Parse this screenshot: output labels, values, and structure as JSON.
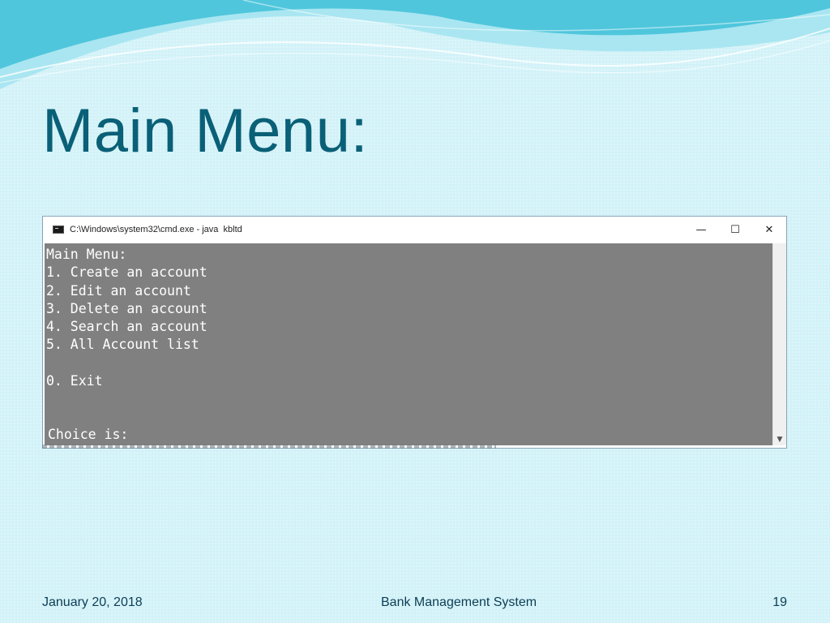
{
  "slide": {
    "title": "Main Menu:",
    "theme_colors": {
      "title": "#0a6077",
      "background": "#d2f2f8",
      "wave_dark": "#4fc6dc",
      "wave_light": "#a9e6f1"
    }
  },
  "console_window": {
    "title": "C:\\Windows\\system32\\cmd.exe - java  kbltd",
    "icon": "console-app-icon",
    "controls": {
      "minimize": "—",
      "maximize": "☐",
      "close": "✕"
    },
    "background_color": "#808080",
    "text_color": "#ffffff",
    "lines": [
      "Main Menu:",
      "1. Create an account",
      "2. Edit an account",
      "3. Delete an account",
      "4. Search an account",
      "5. All Account list",
      "",
      "0. Exit"
    ],
    "prompt": "Choice is:",
    "scroll_down_icon": "chevron-down-icon"
  },
  "footer": {
    "date": "January 20, 2018",
    "center": "Bank Management System",
    "page_number": "19"
  }
}
